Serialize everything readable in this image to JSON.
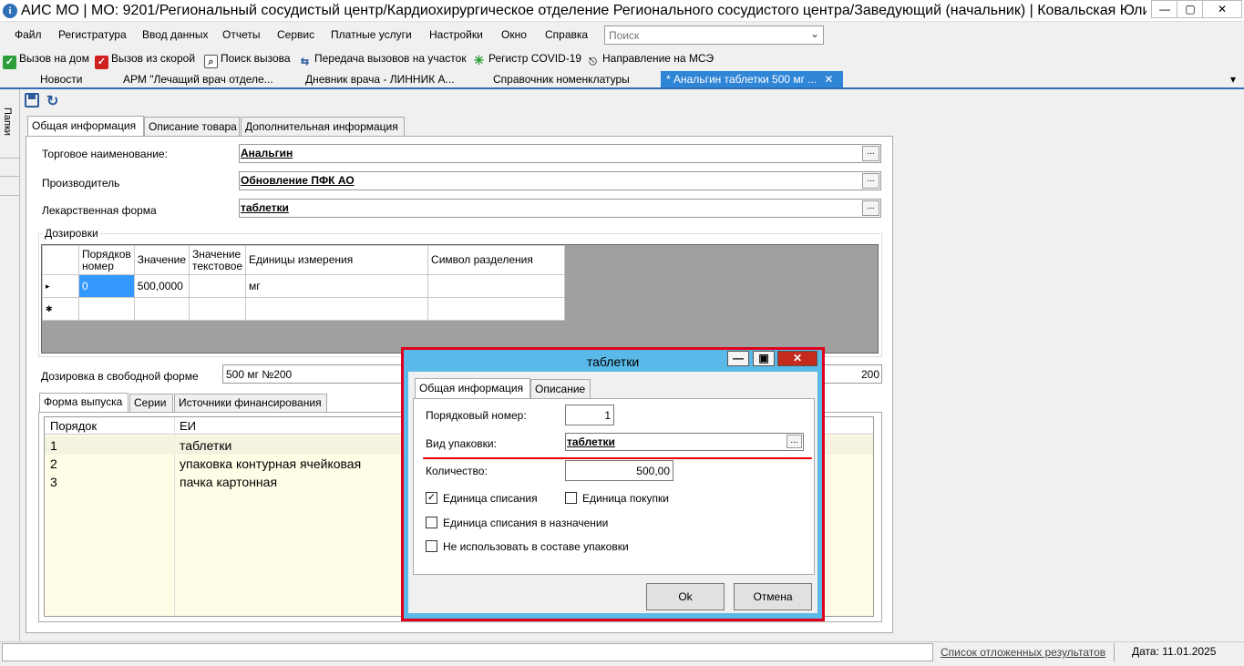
{
  "window": {
    "title": "АИС МО | МО: 9201/Региональный сосудистый центр/Кардиохирургическое отделение Регионального сосудистого центра/Заведующий (начальник) | Ковальская Юлия Сергее...",
    "app_icon": "i",
    "controls": {
      "minimize": "—",
      "maximize": "▢",
      "close": "✕"
    }
  },
  "menu": {
    "items": [
      "Файл",
      "Регистратура",
      "Ввод данных",
      "Отчеты",
      "Сервис",
      "Платные услуги",
      "Настройки",
      "Окно",
      "Справка"
    ],
    "search_placeholder": "Поиск",
    "search_chevron": "⌄"
  },
  "toolbar": {
    "items": [
      {
        "label": "Вызов на дом",
        "icon": "check-icon",
        "color": "#2e9e3a",
        "glyph": "✓"
      },
      {
        "label": "Вызов из скорой",
        "icon": "ambulance-icon",
        "color": "#d02020",
        "glyph": "✓"
      },
      {
        "label": "Поиск вызова",
        "icon": "search-doc-icon",
        "color": "#555555",
        "glyph": "⌕"
      },
      {
        "label": "Передача вызовов на участок",
        "icon": "transfer-icon",
        "color": "#2a5a9b",
        "glyph": "⇆"
      },
      {
        "label": "Регистр COVID-19",
        "icon": "virus-icon",
        "color": "#2e9e3a",
        "glyph": "✳"
      },
      {
        "label": "Направление на МСЭ",
        "icon": "referral-icon",
        "color": "#444444",
        "glyph": "⎋"
      }
    ]
  },
  "doc_tabs": {
    "items": [
      "Новости",
      "АРМ \"Лечащий врач отделе...",
      "Дневник врача - ЛИННИК А...",
      "Справочник номенклатуры"
    ],
    "active": "* Анальгин таблетки 500 мг ...",
    "close": "✕",
    "dropdown": "▾"
  },
  "side": {
    "folders_label": "Папки"
  },
  "form": {
    "tabs": [
      "Общая информация",
      "Описание товара",
      "Дополнительная информация"
    ],
    "trade_name_label": "Торговое наименование:",
    "trade_name_value": "Анальгин",
    "manufacturer_label": "Производитель",
    "manufacturer_value": "Обновление ПФК АО",
    "dosage_form_label": "Лекарственная форма",
    "dosage_form_value": "таблетки",
    "ellipsis": "...",
    "dosages_group": "Дозировки",
    "dosage_columns": [
      "",
      "Порядков номер",
      "Значение",
      "Значение текстовое",
      "Единицы измерения",
      "Символ разделения"
    ],
    "dosage_rows": [
      {
        "marker": "▸",
        "order": "0",
        "value": "500,0000",
        "text": "",
        "unit": "мг",
        "sep": ""
      },
      {
        "marker": "✱",
        "order": "",
        "value": "",
        "text": "",
        "unit": "",
        "sep": ""
      }
    ],
    "free_dosage_label": "Дозировка в свободной форме",
    "free_dosage_value": "500 мг №200",
    "free_dosage_right": "200",
    "release_tabs": [
      "Форма выпуска",
      "Серии",
      "Источники финансирования"
    ],
    "release_columns": [
      "Порядок",
      "ЕИ"
    ],
    "release_rows": [
      {
        "order": "1",
        "unit": "таблетки"
      },
      {
        "order": "2",
        "unit": "упаковка контурная ячейковая"
      },
      {
        "order": "3",
        "unit": "пачка картонная"
      }
    ]
  },
  "dialog": {
    "title": "таблетки",
    "controls": {
      "minimize": "—",
      "maximize": "▣",
      "close": "✕"
    },
    "tabs": [
      "Общая информация",
      "Описание"
    ],
    "seq_label": "Порядковый номер:",
    "seq_value": "1",
    "package_label": "Вид упаковки:",
    "package_value": "таблетки",
    "ellipsis": "...",
    "qty_label": "Количество:",
    "qty_value": "500,00",
    "checks": [
      {
        "label": "Единица списания",
        "checked": true,
        "mark": "✓"
      },
      {
        "label": "Единица покупки",
        "checked": false,
        "mark": ""
      },
      {
        "label": "Единица списания в назначении",
        "checked": false,
        "mark": ""
      },
      {
        "label": "Не использовать в составе упаковки",
        "checked": false,
        "mark": ""
      }
    ],
    "ok": "Ok",
    "cancel": "Отмена"
  },
  "status": {
    "link": "Список отложенных результатов",
    "date": "Дата: 11.01.2025"
  }
}
